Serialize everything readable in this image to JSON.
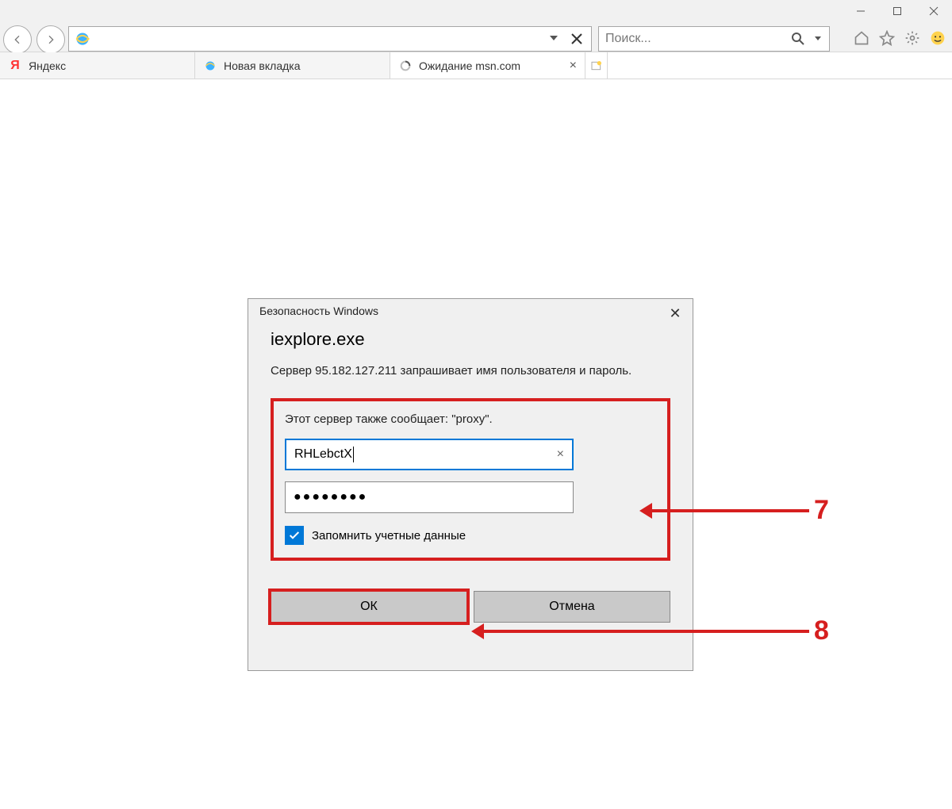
{
  "window_controls": {
    "min": "—",
    "max": "▢",
    "close": "✕"
  },
  "address_bar": {
    "value": ""
  },
  "search_bar": {
    "placeholder": "Поиск..."
  },
  "tabs": [
    {
      "label": "Яндекс"
    },
    {
      "label": "Новая вкладка"
    },
    {
      "label": "Ожидание msn.com"
    }
  ],
  "dialog": {
    "title_small": "Безопасность Windows",
    "title_main": "iexplore.exe",
    "body_line1": "Сервер 95.182.127.211 запрашивает имя пользователя и пароль.",
    "realm_line": "Этот сервер также сообщает: \"proxy\".",
    "username_value": "RHLebctX",
    "password_value": "●●●●●●●●",
    "remember_label": "Запомнить учетные данные",
    "ok_label": "ОК",
    "cancel_label": "Отмена"
  },
  "annotations": {
    "n7": "7",
    "n8": "8"
  }
}
